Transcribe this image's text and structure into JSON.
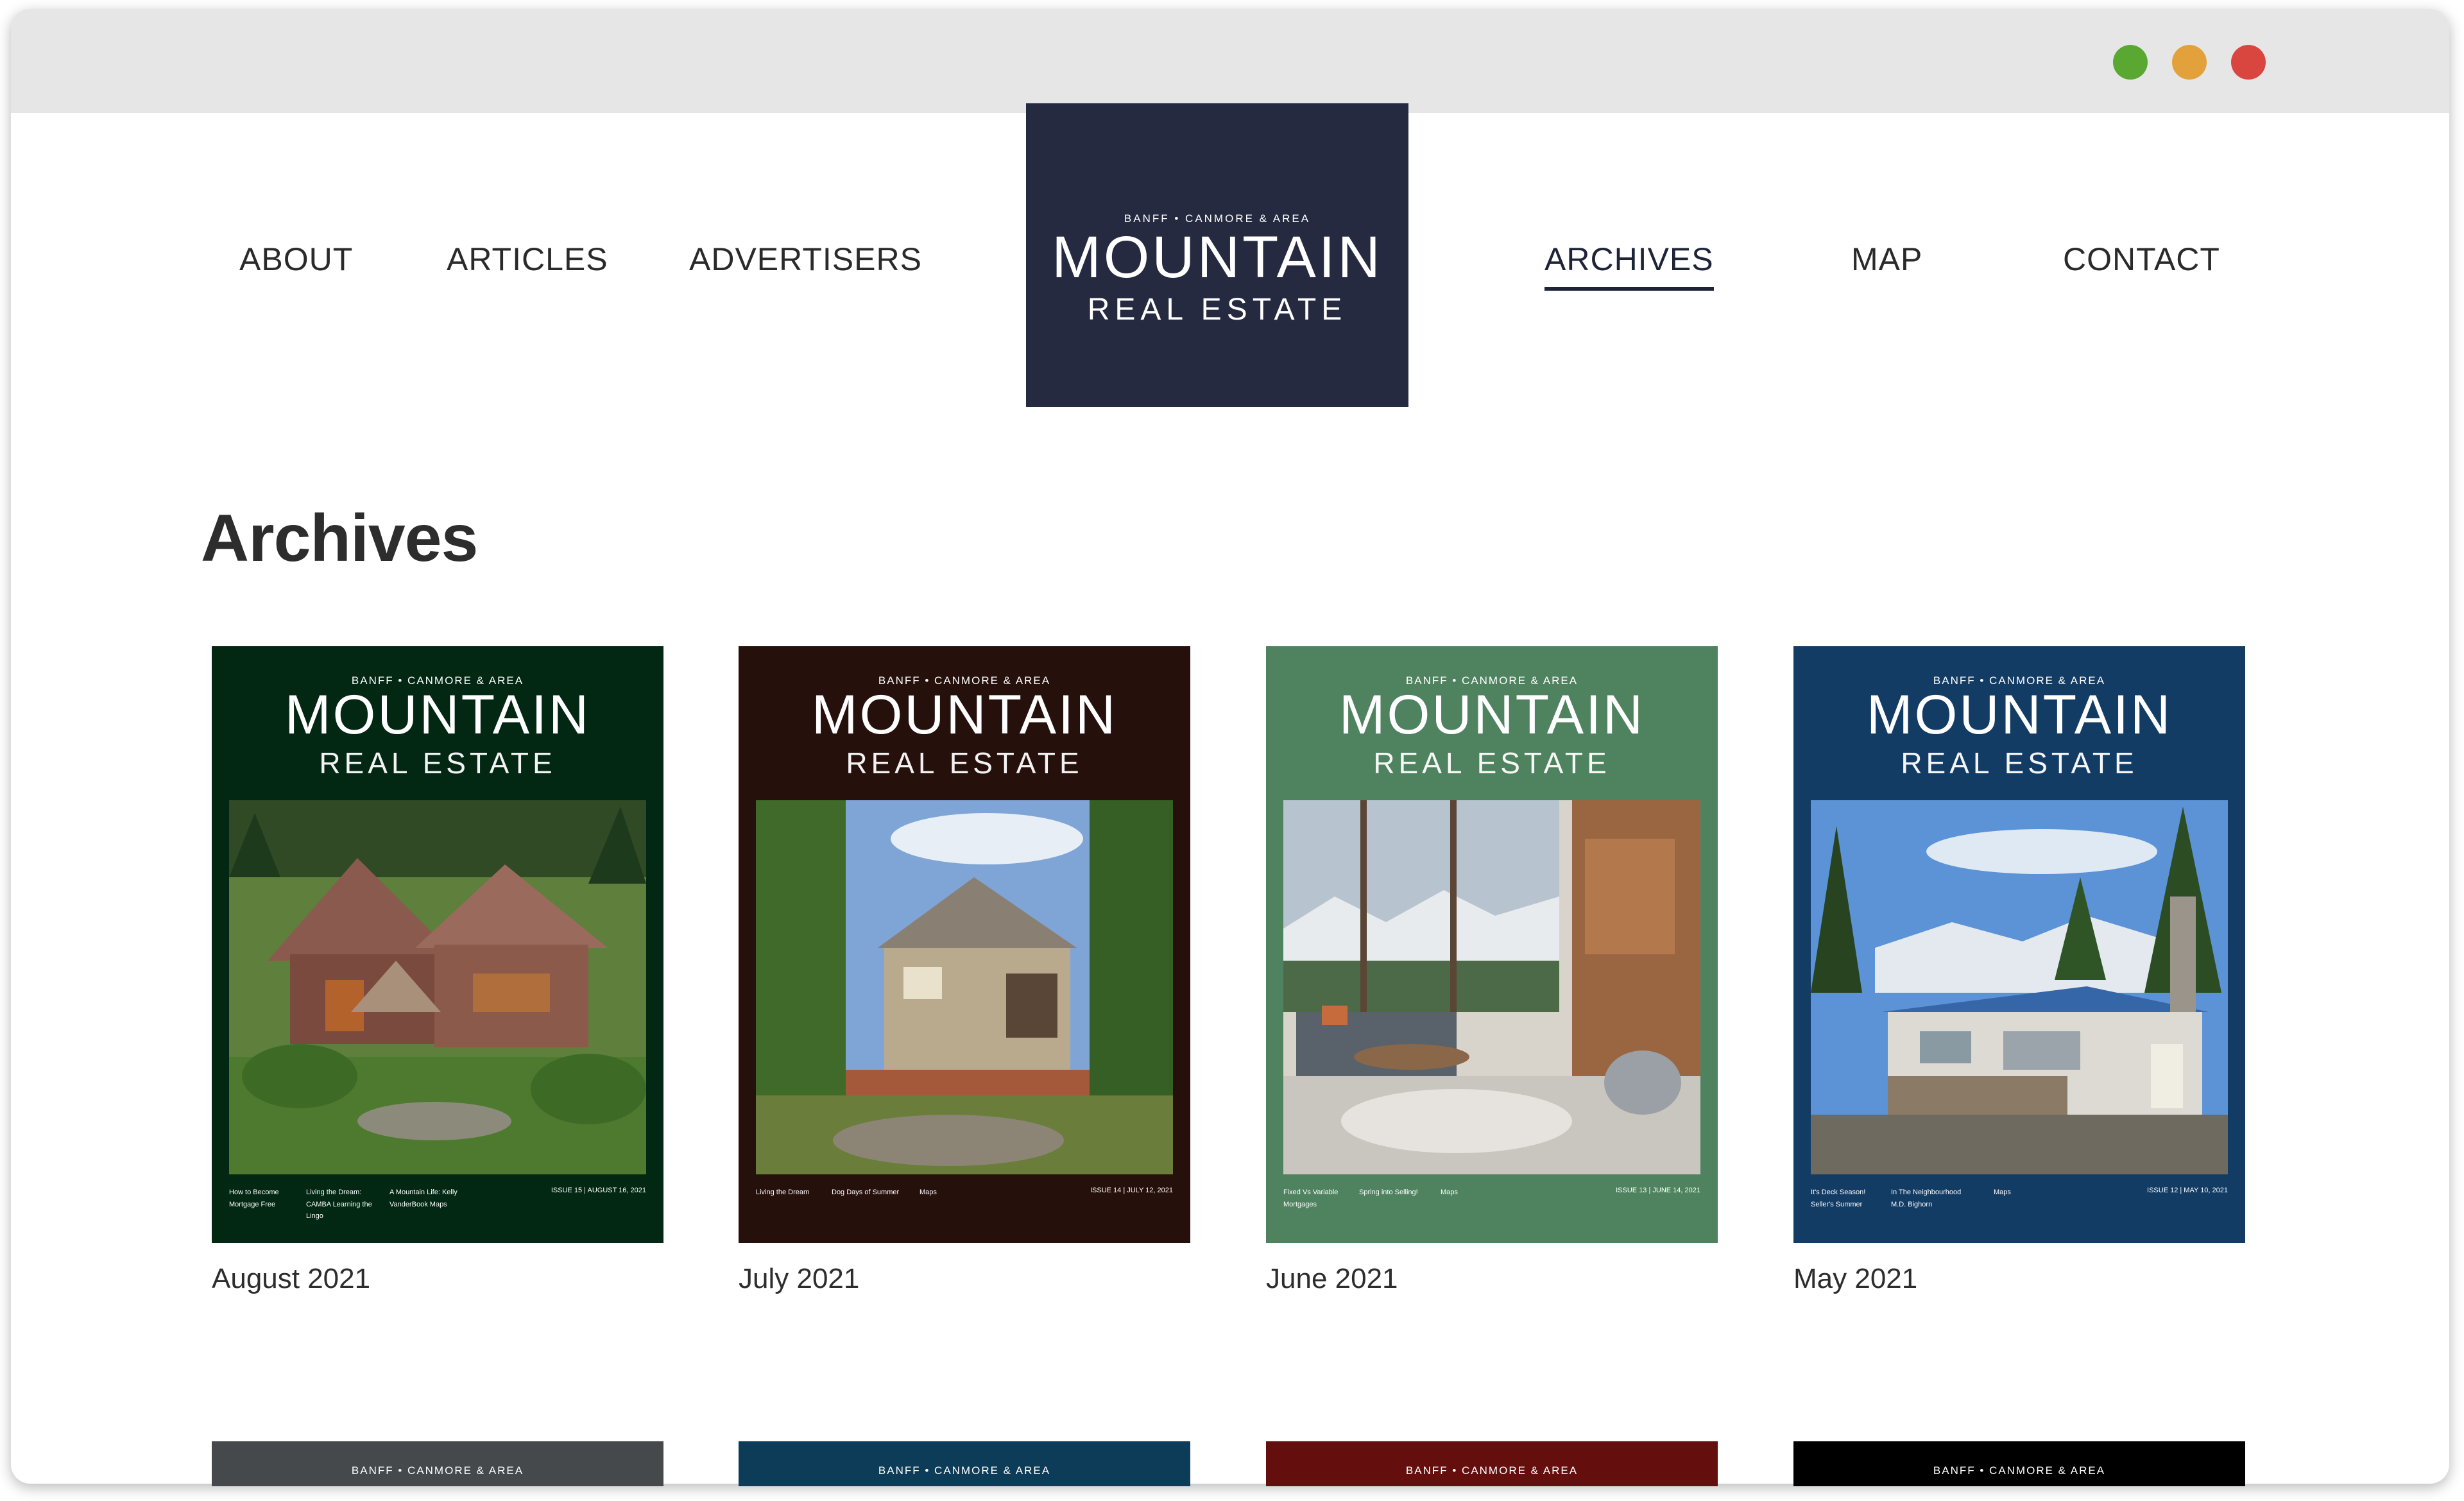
{
  "nav": {
    "left": [
      {
        "label": "ABOUT"
      },
      {
        "label": "ARTICLES"
      },
      {
        "label": "ADVERTISERS"
      }
    ],
    "right": [
      {
        "label": "ARCHIVES",
        "active": true
      },
      {
        "label": "MAP"
      },
      {
        "label": "CONTACT"
      }
    ]
  },
  "logo": {
    "kicker": "BANFF • CANMORE & AREA",
    "title": "MOUNTAIN",
    "subtitle": "REAL ESTATE"
  },
  "page": {
    "title": "Archives"
  },
  "window_controls": {
    "green": "#5aa832",
    "orange": "#e3a13c",
    "red": "#d9463f"
  },
  "brand_color": "#252a40",
  "covers": [
    {
      "caption": "August 2021",
      "bg": "#022713",
      "kicker": "BANFF • CANMORE & AREA",
      "title": "MOUNTAIN",
      "subtitle": "REAL ESTATE",
      "topics": [
        "How to Become Mortgage Free",
        "Living the Dream: CAMBA Learning the Lingo",
        "A Mountain Life: Kelly VanderBook Maps"
      ],
      "issue": "ISSUE 15 | AUGUST 16, 2021"
    },
    {
      "caption": "July 2021",
      "bg": "#26100c",
      "kicker": "BANFF • CANMORE & AREA",
      "title": "MOUNTAIN",
      "subtitle": "REAL ESTATE",
      "topics": [
        "Living the Dream",
        "Dog Days of Summer",
        "Maps"
      ],
      "issue": "ISSUE 14 | JULY 12, 2021"
    },
    {
      "caption": "June 2021",
      "bg": "#4f8360",
      "kicker": "BANFF • CANMORE & AREA",
      "title": "MOUNTAIN",
      "subtitle": "REAL ESTATE",
      "topics": [
        "Fixed Vs Variable Mortgages",
        "Spring into Selling!",
        "Maps"
      ],
      "issue": "ISSUE 13 | JUNE 14, 2021"
    },
    {
      "caption": "May 2021",
      "bg": "#133c65",
      "kicker": "BANFF • CANMORE & AREA",
      "title": "MOUNTAIN",
      "subtitle": "REAL ESTATE",
      "topics": [
        "It's Deck Season! Seller's Summer",
        "In The Neighbourhood M.D. Bighorn",
        "Maps"
      ],
      "issue": "ISSUE 12 | MAY 10, 2021"
    }
  ],
  "next_covers": [
    {
      "bg": "#45494c",
      "kicker": "BANFF • CANMORE & AREA"
    },
    {
      "bg": "#0c3c57",
      "kicker": "BANFF • CANMORE & AREA"
    },
    {
      "bg": "#650e0e",
      "kicker": "BANFF • CANMORE & AREA"
    },
    {
      "bg": "#000000",
      "kicker": "BANFF • CANMORE & AREA"
    }
  ]
}
